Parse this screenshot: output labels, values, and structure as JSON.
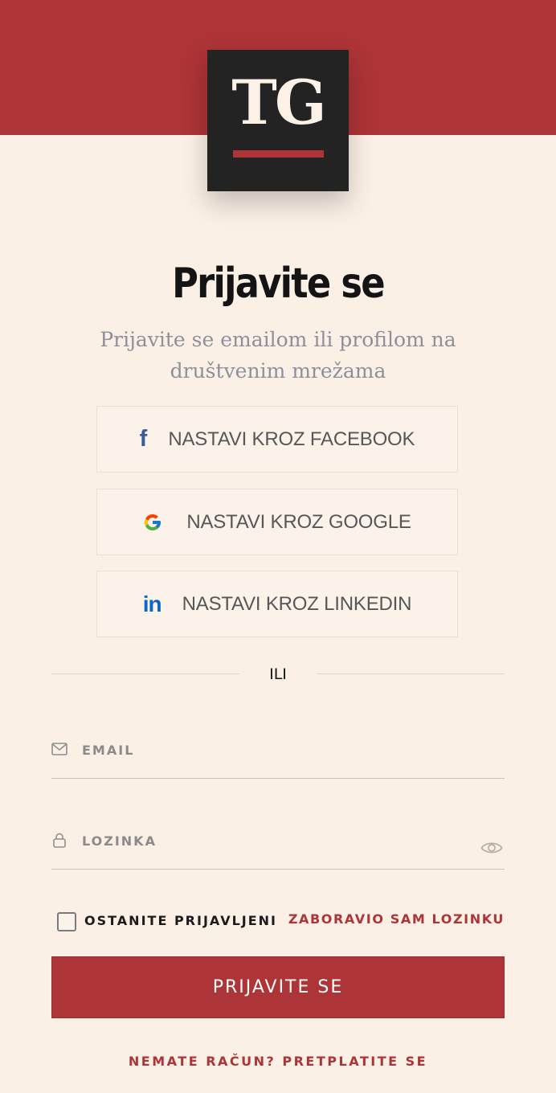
{
  "brand": {
    "logo_text": "TG",
    "accent_color": "#ad3437",
    "background_color": "#faf0e6",
    "logo_background": "#232323"
  },
  "login": {
    "title": "Prijavite se",
    "subtitle": "Prijavite se emailom ili profilom na društvenim mrežama"
  },
  "social": {
    "facebook": {
      "icon": "facebook-icon",
      "glyph": "f",
      "label": "NASTAVI KROZ FACEBOOK"
    },
    "google": {
      "icon": "google-icon",
      "label": "NASTAVI KROZ GOOGLE"
    },
    "linkedin": {
      "icon": "linkedin-icon",
      "glyph": "in",
      "label": "NASTAVI KROZ LINKEDIN"
    }
  },
  "divider": {
    "text": "ILI"
  },
  "form": {
    "email": {
      "icon": "mail-icon",
      "placeholder": "EMAIL",
      "value": ""
    },
    "password": {
      "icon": "lock-icon",
      "placeholder": "LOZINKA",
      "value": "",
      "toggle_icon": "eye-icon"
    },
    "remember_label": "OSTANITE PRIJAVLJENI",
    "remember_checked": false,
    "forgot_label": "ZABORAVIO SAM LOZINKU",
    "submit_label": "PRIJAVITE SE"
  },
  "footer": {
    "signup_label": "NEMATE RAČUN? PRETPLATITE SE"
  }
}
